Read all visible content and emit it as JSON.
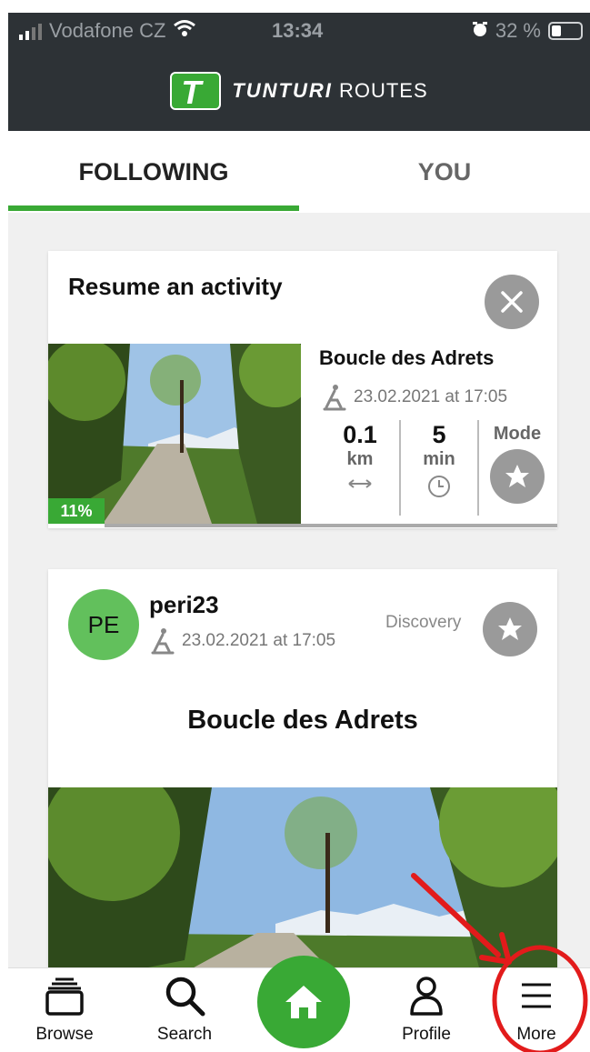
{
  "status_bar": {
    "carrier": "Vodafone CZ",
    "time": "13:34",
    "battery": "32 %",
    "icons": [
      "signal-icon",
      "wifi-icon",
      "alarm-icon",
      "battery-icon"
    ]
  },
  "header": {
    "brand_bold": "TUNTURI",
    "brand_rest": "ROUTES",
    "logo_letter": "T"
  },
  "tabs": [
    {
      "label": "FOLLOWING",
      "active": true
    },
    {
      "label": "YOU",
      "active": false
    }
  ],
  "resume_card": {
    "title": "Resume an activity",
    "route_name": "Boucle des Adrets",
    "datetime": "23.02.2021 at 17:05",
    "progress_label": "11%",
    "progress_fraction": 0.11,
    "distance_value": "0.1",
    "distance_unit": "km",
    "time_value": "5",
    "time_unit": "min",
    "mode_label": "Mode"
  },
  "post_card": {
    "avatar_initials": "PE",
    "username": "peri23",
    "datetime": "23.02.2021 at 17:05",
    "mode": "Discovery",
    "route_name": "Boucle des Adrets"
  },
  "bottom_nav": {
    "browse": "Browse",
    "search": "Search",
    "profile": "Profile",
    "more": "More"
  },
  "colors": {
    "brand_green": "#39a935",
    "header_dark": "#2d3236",
    "annotation_red": "#e21b1b"
  }
}
